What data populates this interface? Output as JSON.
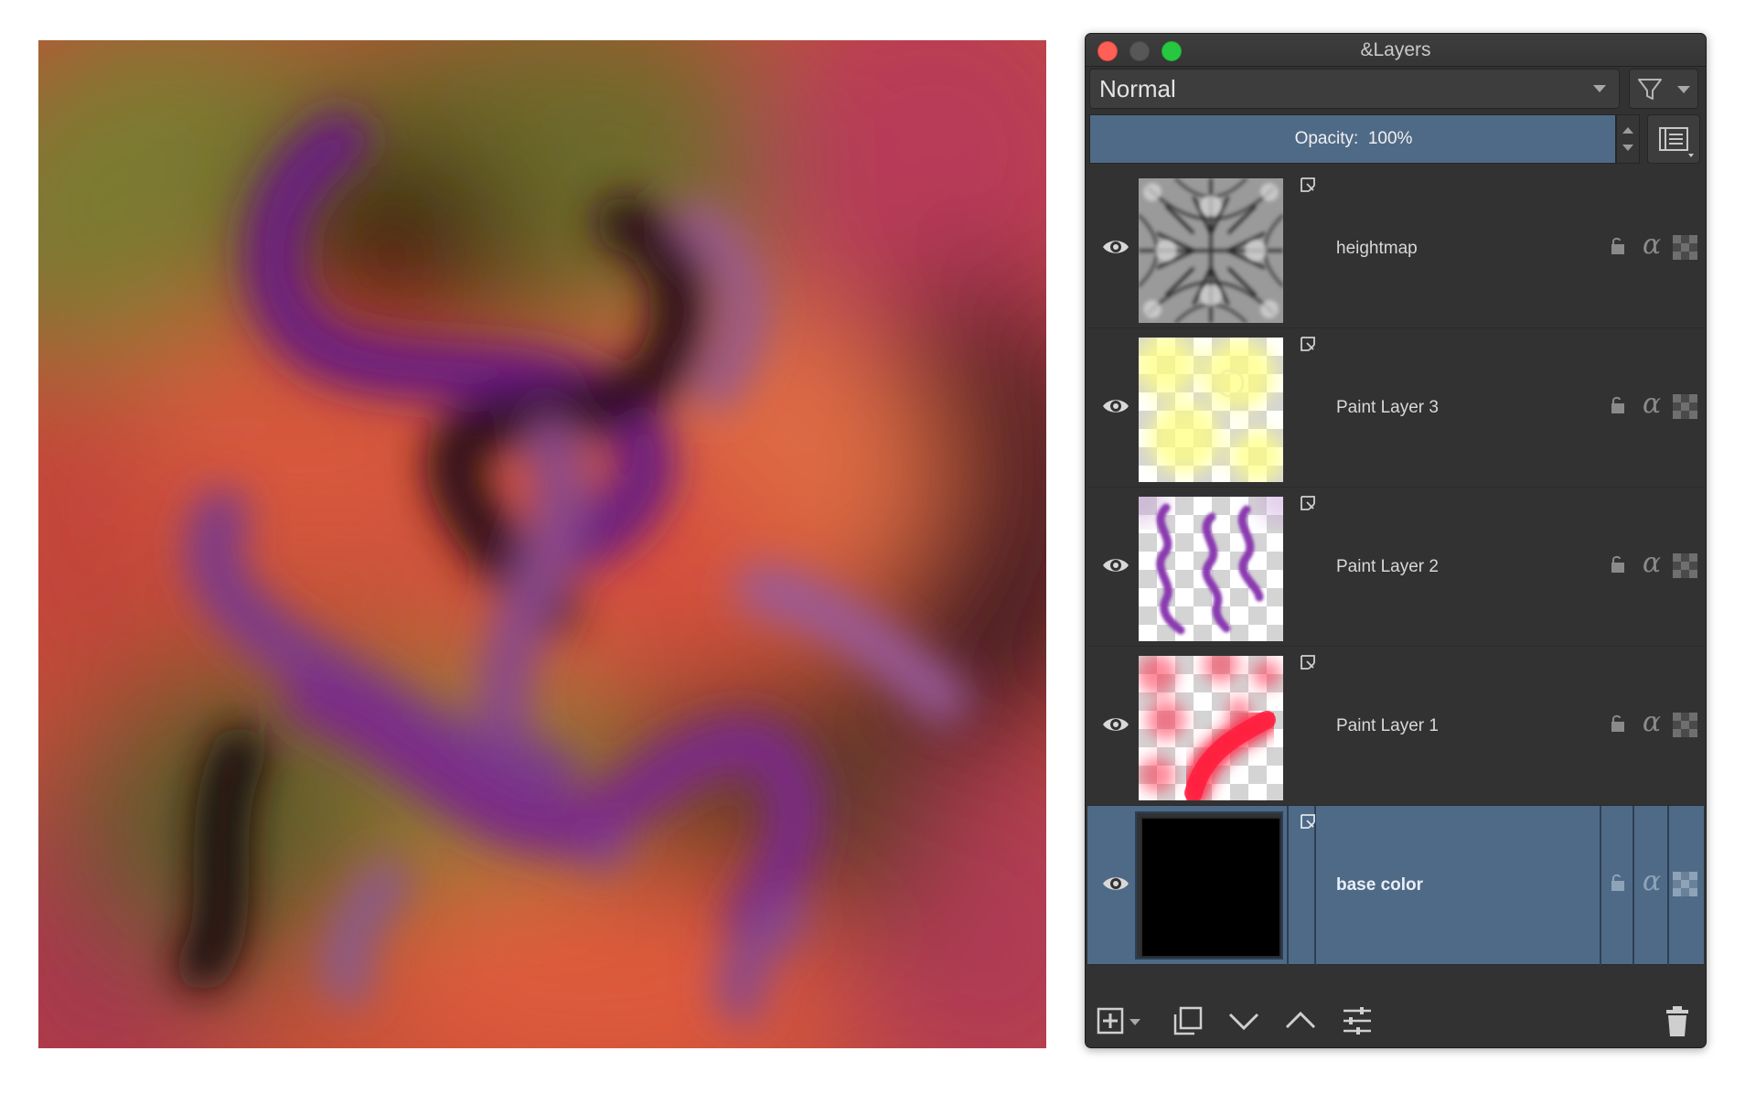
{
  "window": {
    "title": "&Layers"
  },
  "blend_mode": {
    "value": "Normal"
  },
  "opacity": {
    "label": "Opacity:",
    "value": "100%"
  },
  "layers": [
    {
      "name": "heightmap",
      "visible": true,
      "selected": false,
      "thumbnail": "grayscale-heightmap"
    },
    {
      "name": "Paint Layer 3",
      "visible": true,
      "selected": false,
      "thumbnail": "yellow-checker"
    },
    {
      "name": "Paint Layer 2",
      "visible": true,
      "selected": false,
      "thumbnail": "purple-squiggles"
    },
    {
      "name": "Paint Layer 1",
      "visible": true,
      "selected": false,
      "thumbnail": "red-strokes"
    },
    {
      "name": "base color",
      "visible": true,
      "selected": true,
      "thumbnail": "black-fill"
    }
  ],
  "toolbar": {
    "icons": [
      "add-layer-icon",
      "duplicate-layer-icon",
      "move-down-icon",
      "move-up-icon",
      "layer-properties-icon",
      "delete-layer-icon"
    ]
  },
  "colors": {
    "panel_bg": "#323232",
    "selection": "#4f6a87",
    "close": "#fe5f57",
    "maximize": "#27c840"
  }
}
